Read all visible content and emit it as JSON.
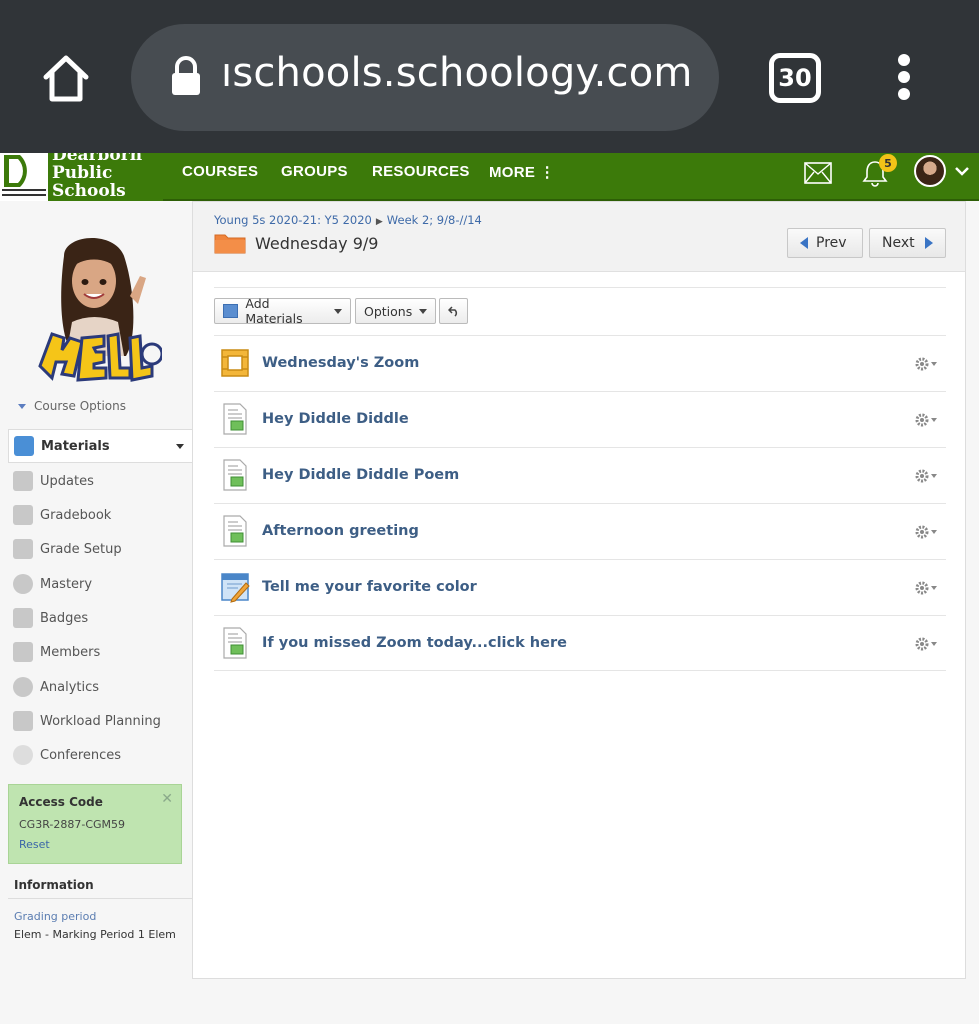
{
  "browser": {
    "url": "ıschools.schoology.com",
    "tab_count": "30"
  },
  "topnav": {
    "logo_line1": "Dearborn",
    "logo_line2": "Public",
    "logo_line3": "Schools",
    "items": [
      "COURSES",
      "GROUPS",
      "RESOURCES",
      "MORE ⋮"
    ],
    "notification_count": "5"
  },
  "sidebar": {
    "course_options": "Course Options",
    "items": [
      {
        "label": "Materials"
      },
      {
        "label": "Updates"
      },
      {
        "label": "Gradebook"
      },
      {
        "label": "Grade Setup"
      },
      {
        "label": "Mastery"
      },
      {
        "label": "Badges"
      },
      {
        "label": "Members"
      },
      {
        "label": "Analytics"
      },
      {
        "label": "Workload Planning"
      },
      {
        "label": "Conferences"
      }
    ],
    "access_code": {
      "title": "Access Code",
      "code": "CG3R-2887-CGM59",
      "reset": "Reset"
    },
    "information": {
      "title": "Information",
      "grading_label": "Grading period",
      "grading_value": "Elem - Marking Period 1 Elem"
    }
  },
  "main": {
    "breadcrumb": [
      "Young 5s 2020-21: Y5 2020",
      "Week 2; 9/8-//14"
    ],
    "title": "Wednesday 9/9",
    "prev": "Prev",
    "next": "Next",
    "toolbar": {
      "add_materials": "Add Materials",
      "options": "Options"
    },
    "materials": [
      {
        "title": "Wednesday's Zoom",
        "icon": "link-icon"
      },
      {
        "title": "Hey Diddle Diddle",
        "icon": "page-icon"
      },
      {
        "title": "Hey Diddle Diddle Poem",
        "icon": "page-icon"
      },
      {
        "title": "Afternoon greeting",
        "icon": "page-icon"
      },
      {
        "title": "Tell me your favorite color",
        "icon": "assignment-icon"
      },
      {
        "title": "If you missed Zoom today...click here",
        "icon": "page-icon"
      }
    ]
  }
}
